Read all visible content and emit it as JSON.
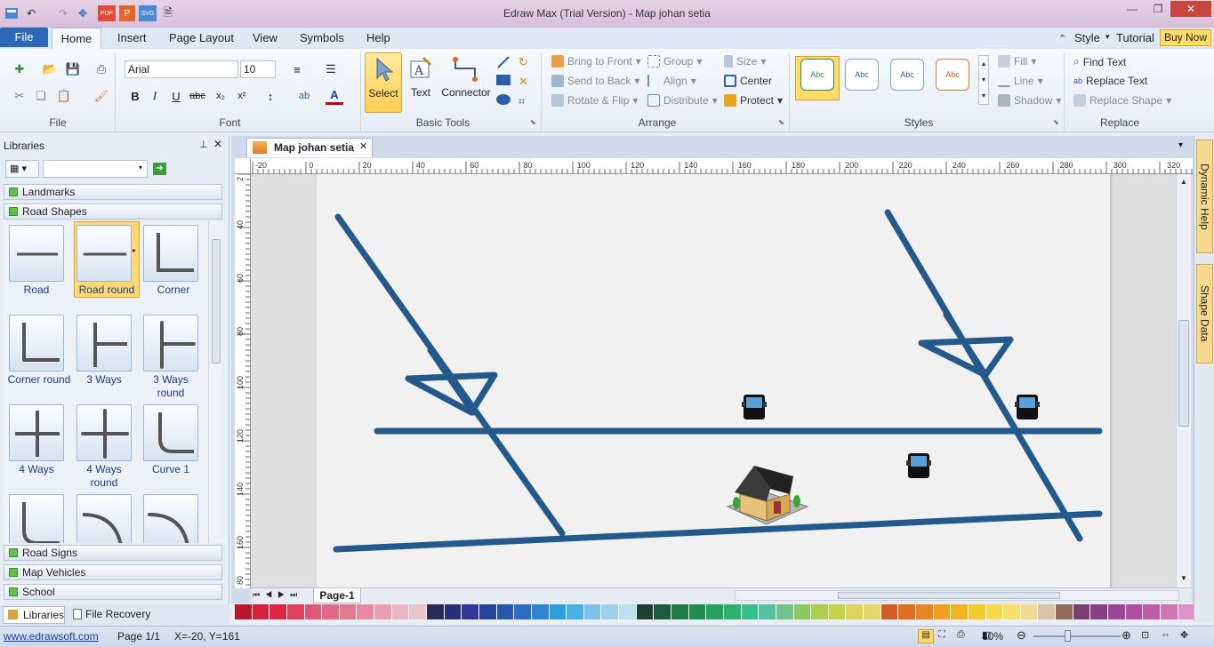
{
  "window": {
    "title": "Edraw Max (Trial Version) - Map johan setia"
  },
  "menu": {
    "file": "File",
    "home": "Home",
    "insert": "Insert",
    "page_layout": "Page Layout",
    "view": "View",
    "symbols": "Symbols",
    "help": "Help",
    "style": "Style",
    "tutorial": "Tutorial",
    "buy_now": "Buy Now"
  },
  "ribbon": {
    "file_group": "File",
    "font_group": "Font",
    "font_name": "Arial",
    "font_size": "10",
    "basic_tools_group": "Basic Tools",
    "select": "Select",
    "text": "Text",
    "connector": "Connector",
    "arrange_group": "Arrange",
    "bring_to_front": "Bring to Front",
    "send_to_back": "Send to Back",
    "rotate_flip": "Rotate & Flip",
    "group": "Group",
    "align": "Align",
    "distribute": "Distribute",
    "size": "Size",
    "center": "Center",
    "protect": "Protect",
    "styles_group": "Styles",
    "style_sample": "Abc",
    "fill": "Fill",
    "line": "Line",
    "shadow": "Shadow",
    "replace_group": "Replace",
    "find_text": "Find Text",
    "replace_text": "Replace Text",
    "replace_shape": "Replace Shape"
  },
  "libraries": {
    "title": "Libraries",
    "categories": [
      "Landmarks",
      "Road Shapes",
      "Road Signs",
      "Map Vehicles",
      "School"
    ],
    "shapes": [
      {
        "label": "Road",
        "label2": ""
      },
      {
        "label": "Road round",
        "label2": ""
      },
      {
        "label": "Corner",
        "label2": ""
      },
      {
        "label": "Corner round",
        "label2": ""
      },
      {
        "label": "3 Ways",
        "label2": ""
      },
      {
        "label": "3 Ways",
        "label2": "round"
      },
      {
        "label": "4 Ways",
        "label2": ""
      },
      {
        "label": "4 Ways",
        "label2": "round"
      },
      {
        "label": "Curve 1",
        "label2": ""
      }
    ],
    "bottom_tabs": [
      "Libraries",
      "File Recovery"
    ]
  },
  "document": {
    "tab": "Map johan setia",
    "page_tab": "Page-1",
    "h_ruler": [
      "-20",
      "0",
      "20",
      "40",
      "60",
      "80",
      "100",
      "120",
      "140",
      "160",
      "180",
      "200",
      "220",
      "240",
      "260",
      "280",
      "300",
      "320"
    ],
    "v_ruler": [
      "2",
      "40",
      "60",
      "80",
      "100",
      "120",
      "140",
      "160",
      "80"
    ]
  },
  "right_panes": {
    "dynamic_help": "Dynamic Help",
    "shape_data": "Shape Data"
  },
  "status": {
    "website": "www.edrawsoft.com",
    "page": "Page 1/1",
    "coords": "X=-20, Y=161",
    "zoom": "80%"
  },
  "colors": {
    "road": "#24598c",
    "palette": [
      "#b8162b",
      "#d6213b",
      "#e02645",
      "#e0405c",
      "#e0577a",
      "#e06a84",
      "#e07a8e",
      "#e88a9e",
      "#e6a0b0",
      "#eeb5c2",
      "#e8c4cc",
      "#2a2a58",
      "#2b2f7a",
      "#31369a",
      "#27429b",
      "#2857ad",
      "#2c6ec4",
      "#2b86d0",
      "#2e9ee0",
      "#4ab1e6",
      "#79c3e9",
      "#9fd1ea",
      "#bfe0ef",
      "#1e3e2e",
      "#1d5b3c",
      "#1f7a45",
      "#208d4d",
      "#24a15a",
      "#2bb36e",
      "#34c088",
      "#53c0a0",
      "#70c48c",
      "#8cc861",
      "#a8d04d",
      "#c2d44a",
      "#dbd55a",
      "#e6d76b",
      "#d35b25",
      "#e07020",
      "#e88520",
      "#efa01f",
      "#f2b321",
      "#f2c92f",
      "#f6da49",
      "#f7e06a",
      "#f2d98e",
      "#d8c5a6",
      "#8f6b5a",
      "#7a3f6e",
      "#8a3e84",
      "#9e4498",
      "#b34aa4",
      "#c25aa8",
      "#cf75b5",
      "#dc93c7"
    ]
  }
}
